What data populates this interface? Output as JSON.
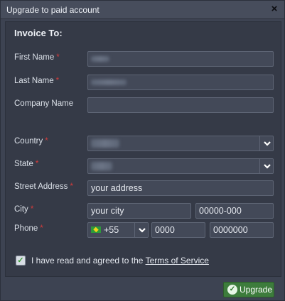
{
  "dialog": {
    "title": "Upgrade to paid account",
    "close_label": "×"
  },
  "invoice": {
    "section_title": "Invoice To:",
    "required_mark": "*",
    "labels": {
      "first_name": "First Name",
      "last_name": "Last Name",
      "company_name": "Company Name",
      "country": "Country",
      "state": "State",
      "street_address": "Street Address",
      "city": "City",
      "phone": "Phone"
    },
    "values": {
      "street_address": "your address",
      "city": "your city",
      "zip": "00000-000",
      "phone_country_code": "+55",
      "phone_area": "0000",
      "phone_number": "0000000"
    }
  },
  "agreement": {
    "checked": true,
    "check_glyph": "✓",
    "text": "I have read and agreed to the",
    "link_text": "Terms of Service"
  },
  "actions": {
    "upgrade_label": "Upgrade",
    "upgrade_icon_glyph": "✓"
  },
  "colors": {
    "dialog_bg": "#3d4352",
    "panel_bg": "#353a47",
    "field_bg": "#434958",
    "required": "#d33b3b",
    "upgrade_button": "#3d7c3c"
  }
}
